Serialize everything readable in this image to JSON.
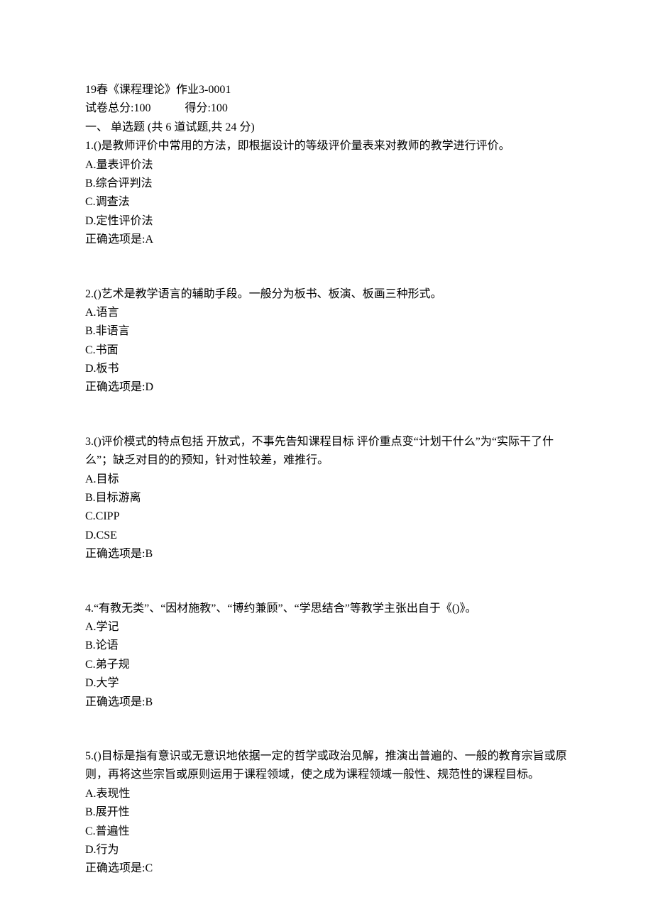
{
  "header": {
    "title": "19春《课程理论》作业3-0001",
    "total_label": "试卷总分:",
    "total_value": "100",
    "score_label": "得分:",
    "score_value": "100",
    "section_label": "一、  单选题 (共 6 道试题,共 24 分)"
  },
  "answer_prefix": "正确选项是:",
  "questions": [
    {
      "stem": "1.()是教师评价中常用的方法，即根据设计的等级评价量表来对教师的教学进行评价。",
      "options": [
        "A.量表评价法",
        "B.综合评判法",
        "C.调查法",
        "D.定性评价法"
      ],
      "answer": "A"
    },
    {
      "stem": "2.()艺术是教学语言的辅助手段。一般分为板书、板演、板画三种形式。",
      "options": [
        "A.语言",
        "B.非语言",
        "C.书面",
        "D.板书"
      ],
      "answer": "D"
    },
    {
      "stem": "3.()评价模式的特点包括 开放式，不事先告知课程目标 评价重点变“计划干什么”为“实际干了什么”；缺乏对目的的预知，针对性较差，难推行。",
      "options": [
        "A.目标",
        "B.目标游离",
        "C.CIPP",
        "D.CSE"
      ],
      "answer": "B"
    },
    {
      "stem": "4.“有教无类”、“因材施教”、“博约兼顾”、“学思结合”等教学主张出自于《()》。",
      "options": [
        "A.学记",
        "B.论语",
        "C.弟子规",
        "D.大学"
      ],
      "answer": "B"
    },
    {
      "stem": "5.()目标是指有意识或无意识地依据一定的哲学或政治见解，推演出普遍的、一般的教育宗旨或原则，再将这些宗旨或原则运用于课程领域，使之成为课程领域一般性、规范性的课程目标。",
      "options": [
        "A.表现性",
        "B.展开性",
        "C.普遍性",
        "D.行为"
      ],
      "answer": "C"
    }
  ]
}
